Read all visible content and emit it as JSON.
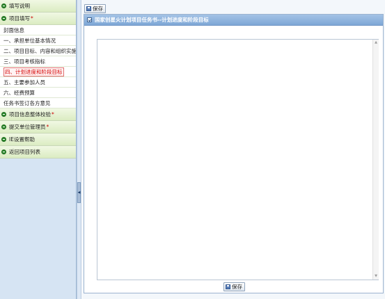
{
  "sidebar": {
    "items": [
      {
        "type": "group",
        "label": "填写说明",
        "star": "",
        "icon": "green-circle-icon"
      },
      {
        "type": "group",
        "label": "项目填写",
        "star": "*",
        "icon": "green-circle-icon"
      },
      {
        "type": "item",
        "label": "封面信息",
        "active": false
      },
      {
        "type": "item",
        "label": "一、承担单位基本情况",
        "active": false
      },
      {
        "type": "item",
        "label": "二、项目目标、内容和组织实施",
        "active": false
      },
      {
        "type": "item",
        "label": "三、项目考核指标",
        "active": false
      },
      {
        "type": "item",
        "label": "四、计划进度和阶段目标",
        "active": true
      },
      {
        "type": "item",
        "label": "五、主要参加人员",
        "active": false
      },
      {
        "type": "item",
        "label": "六、经费预算",
        "active": false
      },
      {
        "type": "item",
        "label": "任务书签订各方意见",
        "active": false
      },
      {
        "type": "group",
        "label": "项目信息整体校验",
        "star": "*",
        "icon": "green-circle-icon"
      },
      {
        "type": "group",
        "label": "提交单位管理员",
        "star": "*",
        "icon": "green-circle-icon"
      },
      {
        "type": "group",
        "label": "IE设置帮助",
        "star": "",
        "icon": "green-circle-icon"
      },
      {
        "type": "group",
        "label": "返回项目列表",
        "star": "",
        "icon": "green-circle-icon"
      }
    ]
  },
  "toolbar": {
    "save_label": "保存"
  },
  "panel": {
    "title": "国家创星火计划项目任务书--计划进度和阶段目标",
    "content": ""
  },
  "footer": {
    "save_label": "保存"
  },
  "colors": {
    "accent": "#7ea7d6",
    "active_item": "#d40000",
    "group_bg": "#dbecc2",
    "sidebar_bg": "#d6e4f3"
  }
}
